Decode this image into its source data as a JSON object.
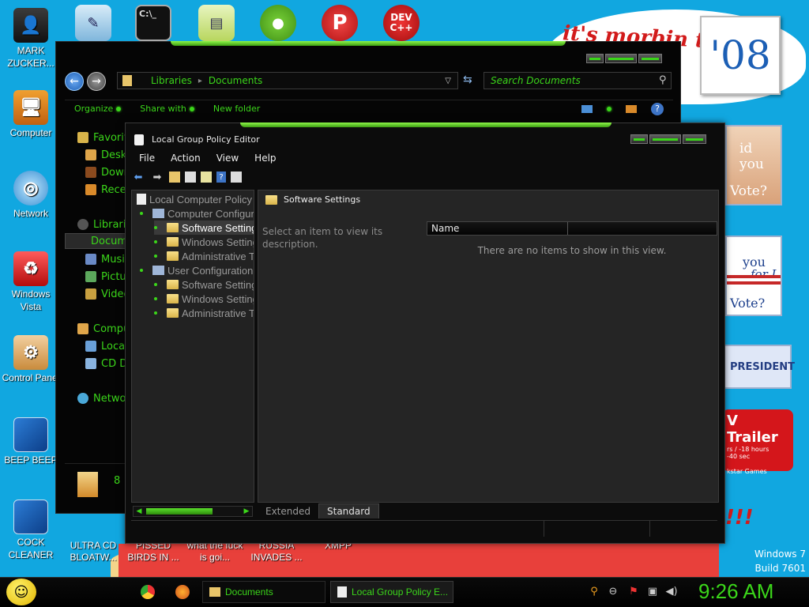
{
  "desktop": {
    "icons_left": [
      {
        "label": "MARK ZUCKER...",
        "icon": "person-icon"
      },
      {
        "label": "Computer",
        "icon": "computer-icon"
      },
      {
        "label": "Network",
        "icon": "network-icon"
      },
      {
        "label": "Windows Vista",
        "icon": "recycle-bin-icon"
      },
      {
        "label": "Control Panel",
        "icon": "control-panel-icon"
      },
      {
        "label": "BEEP BEEP",
        "icon": "file-icon"
      },
      {
        "label": "COCK CLEANER",
        "icon": "file-icon"
      }
    ],
    "icons_top": [
      {
        "icon": "notepad-icon"
      },
      {
        "icon": "cmd-icon"
      },
      {
        "icon": "app-icon"
      },
      {
        "icon": "angry-birds-icon"
      },
      {
        "icon": "p-icon",
        "text": "P"
      },
      {
        "icon": "devcpp-icon",
        "text": "DEV C++"
      }
    ],
    "icons_bottom": [
      {
        "label": "ULTRA CD BLOATW..."
      },
      {
        "label": "PISSED BIRDS IN ..."
      },
      {
        "label": "what the fuck is goi..."
      },
      {
        "label": "RUSSIA INVADES ..."
      },
      {
        "label": "XMPP"
      }
    ],
    "wallpaper": {
      "morbin_text": "it's morbin t",
      "year_text": "'08",
      "id_text": "id you",
      "vote_text": "Vote?",
      "you_text": "you",
      "for_text": "for I",
      "vote2_text": "Vote?",
      "president_text": "PRESIDENT",
      "trailer_title": "V Trailer",
      "trailer_line1": "rs / -18 hours",
      "trailer_line2": "-40 sec",
      "trailer_line3": "kstar Games",
      "bang_text": "!!!",
      "windows_version": "Windows 7",
      "build": "Build 7601"
    }
  },
  "explorer": {
    "breadcrumb": [
      "Libraries",
      "Documents"
    ],
    "search_placeholder": "Search Documents",
    "toolbar": {
      "organize": "Organize",
      "share_with": "Share with",
      "new_folder": "New folder"
    },
    "nav_items": [
      {
        "label": "Favorites",
        "icon": "star-icon"
      },
      {
        "label": "Desktop",
        "icon": "desktop-icon"
      },
      {
        "label": "Downloads",
        "icon": "downloads-icon"
      },
      {
        "label": "Recent Places",
        "icon": "recent-icon"
      },
      {
        "label": "Libraries",
        "icon": "library-icon"
      },
      {
        "label": "Documents",
        "icon": "documents-icon",
        "selected": true
      },
      {
        "label": "Music",
        "icon": "music-icon"
      },
      {
        "label": "Pictures",
        "icon": "pictures-icon"
      },
      {
        "label": "Videos",
        "icon": "videos-icon"
      },
      {
        "label": "Computer",
        "icon": "computer-icon"
      },
      {
        "label": "Local Disk",
        "icon": "disk-icon"
      },
      {
        "label": "CD Drive",
        "icon": "cd-icon"
      },
      {
        "label": "Network",
        "icon": "network-icon"
      }
    ],
    "details_count": "8"
  },
  "gpe": {
    "title": "Local Group Policy Editor",
    "menu": [
      "File",
      "Action",
      "View",
      "Help"
    ],
    "tree": [
      {
        "label": "Local Computer Policy",
        "level": 0
      },
      {
        "label": "Computer Configuration",
        "level": 1
      },
      {
        "label": "Software Settings",
        "level": 2,
        "selected": true
      },
      {
        "label": "Windows Settings",
        "level": 2
      },
      {
        "label": "Administrative Templates",
        "level": 2
      },
      {
        "label": "User Configuration",
        "level": 1
      },
      {
        "label": "Software Settings",
        "level": 2
      },
      {
        "label": "Windows Settings",
        "level": 2
      },
      {
        "label": "Administrative Templates",
        "level": 2
      }
    ],
    "right_header": "Software Settings",
    "description_hint": "Select an item to view its description.",
    "column_name": "Name",
    "empty_message": "There are no items to show in this view.",
    "tabs": [
      {
        "label": "Extended",
        "active": false
      },
      {
        "label": "Standard",
        "active": true
      }
    ]
  },
  "taskbar": {
    "buttons": [
      {
        "label": "Documents",
        "icon": "folder-icon",
        "active": false
      },
      {
        "label": "Local Group Policy E...",
        "icon": "policy-icon",
        "active": true
      }
    ],
    "clock": "9:26 AM"
  }
}
